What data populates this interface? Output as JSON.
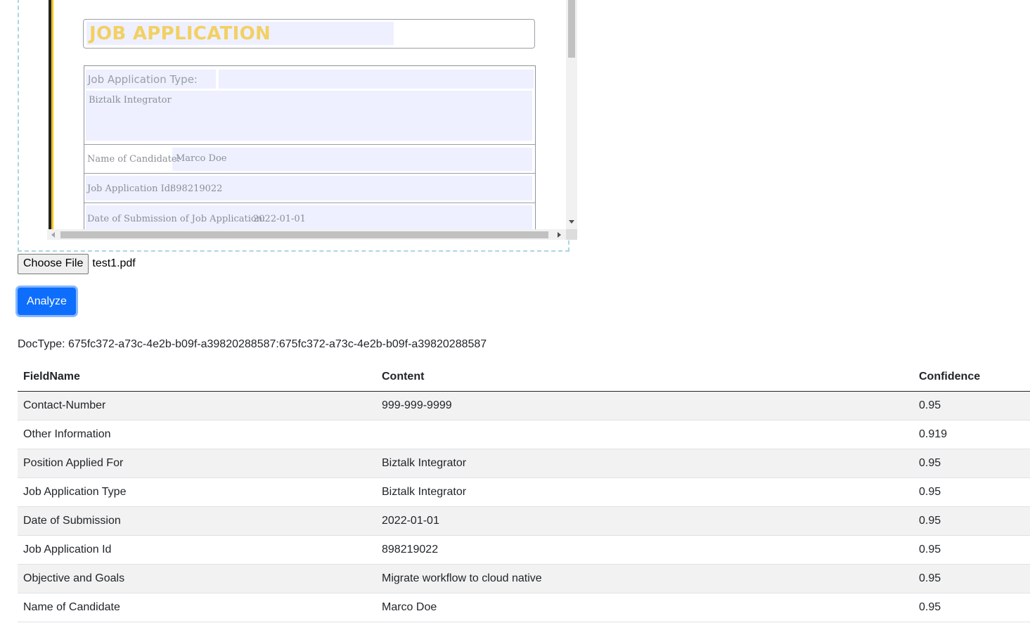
{
  "pdf_preview": {
    "title": "JOB APPLICATION",
    "fields": [
      {
        "label": "Job Application Type:",
        "value": "Biztalk Integrator"
      },
      {
        "label": "Name of Candidate:",
        "value": "Marco Doe"
      },
      {
        "label": "Job Application Id:",
        "value": "898219022"
      },
      {
        "label": "Date of Submission of Job Application:",
        "value": "2022-01-01"
      }
    ]
  },
  "file_input": {
    "button_label": "Choose File",
    "file_name": "test1.pdf"
  },
  "analyze_label": "Analyze",
  "doctype": "DocType: 675fc372-a73c-4e2b-b09f-a39820288587:675fc372-a73c-4e2b-b09f-a39820288587",
  "table": {
    "headers": [
      "FieldName",
      "Content",
      "Confidence"
    ],
    "rows": [
      [
        "Contact-Number",
        "999-999-9999",
        "0.95"
      ],
      [
        "Other Information",
        "",
        "0.919"
      ],
      [
        "Position Applied For",
        "Biztalk Integrator",
        "0.95"
      ],
      [
        "Job Application Type",
        "Biztalk Integrator",
        "0.95"
      ],
      [
        "Date of Submission",
        "2022-01-01",
        "0.95"
      ],
      [
        "Job Application Id",
        "898219022",
        "0.95"
      ],
      [
        "Objective and Goals",
        "Migrate workflow to cloud native",
        "0.95"
      ],
      [
        "Name of Candidate",
        "Marco Doe",
        "0.95"
      ]
    ]
  },
  "colors": {
    "accent": "#0d6efd",
    "title": "#f2d063",
    "field_fill": "#eef0ff",
    "stripe_gold": "#f3c318"
  }
}
